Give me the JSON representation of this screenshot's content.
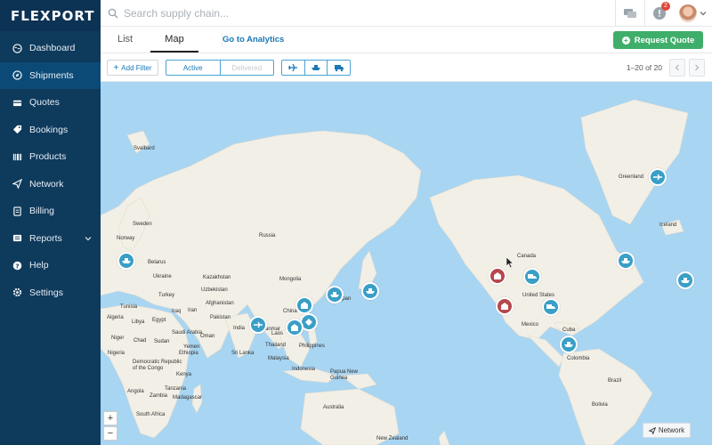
{
  "brand": {
    "logo_text": "FLEXPORT"
  },
  "sidebar": {
    "items": [
      {
        "label": "Dashboard",
        "icon": "globe-icon",
        "active": false
      },
      {
        "label": "Shipments",
        "icon": "compass-icon",
        "active": true
      },
      {
        "label": "Quotes",
        "icon": "card-icon",
        "active": false
      },
      {
        "label": "Bookings",
        "icon": "tag-icon",
        "active": false
      },
      {
        "label": "Products",
        "icon": "barcode-icon",
        "active": false
      },
      {
        "label": "Network",
        "icon": "send-icon",
        "active": false
      },
      {
        "label": "Billing",
        "icon": "document-icon",
        "active": false
      },
      {
        "label": "Reports",
        "icon": "list-icon",
        "active": false
      },
      {
        "label": "Help",
        "icon": "question-icon",
        "active": false
      },
      {
        "label": "Settings",
        "icon": "gear-icon",
        "active": false
      }
    ]
  },
  "search": {
    "placeholder": "Search supply chain..."
  },
  "header": {
    "notification_count": "2"
  },
  "tabs": {
    "list_label": "List",
    "map_label": "Map",
    "analytics_label": "Go to Analytics"
  },
  "request_quote": {
    "label": "Request Quote"
  },
  "filters": {
    "add_filter_label": "Add Filter",
    "status_active": "Active",
    "status_delivered": "Delivered",
    "modes": [
      "air-icon",
      "ocean-icon",
      "truck-icon"
    ]
  },
  "pagination": {
    "range_text": "1–20 of 20"
  },
  "map": {
    "places": [
      "Svalbard",
      "Greenland",
      "Iceland",
      "Russia",
      "Canada",
      "United States",
      "Mexico",
      "Cuba",
      "Colombia",
      "Brazil",
      "Bolivia",
      "Norway",
      "Sweden",
      "Belarus",
      "Ukraine",
      "Turkey",
      "Tunisia",
      "Algeria",
      "Libya",
      "Egypt",
      "Niger",
      "Chad",
      "Nigeria",
      "Sudan",
      "Ethiopia",
      "Kenya",
      "Tanzania",
      "Democratic Republic of the Congo",
      "Angola",
      "Zambia",
      "Madagascar",
      "South Africa",
      "Kazakhstan",
      "Uzbekistan",
      "Afghanistan",
      "Pakistan",
      "Iran",
      "Iraq",
      "Saudi Arabia",
      "Oman",
      "Yemen",
      "Mongolia",
      "China",
      "India",
      "Sri Lanka",
      "Myanmar",
      "Laos",
      "Thailand",
      "Philippines",
      "Malaysia",
      "Indonesia",
      "Papua New Guinea",
      "Australia",
      "New Zealand",
      "Japan"
    ],
    "network_label": "Network",
    "zoom_in_label": "+",
    "zoom_out_label": "−"
  },
  "colors": {
    "sidebar_bg": "#0e3a5c",
    "accent": "#1a78b6",
    "marker_active": "#3a9fc7",
    "marker_alert": "#b5474d",
    "request_green": "#3fae6a",
    "ocean": "#a8d5f2",
    "land": "#f2efe6"
  }
}
